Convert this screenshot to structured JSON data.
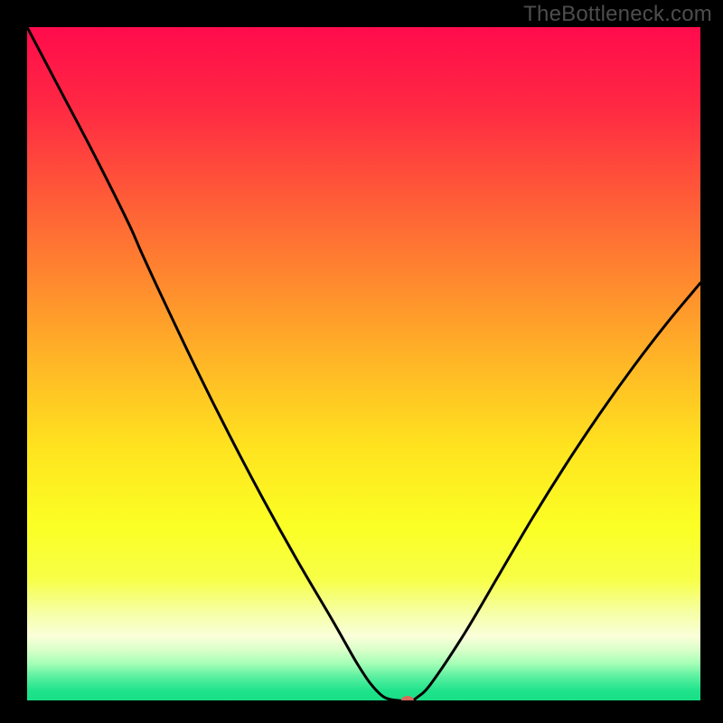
{
  "watermark": "TheBottleneck.com",
  "chart_data": {
    "type": "line",
    "title": "",
    "xlabel": "",
    "ylabel": "",
    "xlim": [
      0,
      100
    ],
    "ylim": [
      0,
      100
    ],
    "background_gradient": {
      "stops": [
        {
          "offset": 0.0,
          "color": "#ff0b4c"
        },
        {
          "offset": 0.12,
          "color": "#ff2943"
        },
        {
          "offset": 0.25,
          "color": "#ff5a38"
        },
        {
          "offset": 0.38,
          "color": "#ff8a2e"
        },
        {
          "offset": 0.5,
          "color": "#ffb726"
        },
        {
          "offset": 0.62,
          "color": "#ffe21f"
        },
        {
          "offset": 0.74,
          "color": "#fbff24"
        },
        {
          "offset": 0.82,
          "color": "#f7ff47"
        },
        {
          "offset": 0.87,
          "color": "#f6ffa6"
        },
        {
          "offset": 0.905,
          "color": "#faffd9"
        },
        {
          "offset": 0.925,
          "color": "#d9ffc9"
        },
        {
          "offset": 0.945,
          "color": "#a6ffb6"
        },
        {
          "offset": 0.965,
          "color": "#5af0a0"
        },
        {
          "offset": 0.985,
          "color": "#20e38b"
        },
        {
          "offset": 1.0,
          "color": "#19df86"
        }
      ]
    },
    "series": [
      {
        "name": "bottleneck-curve",
        "x": [
          0,
          5,
          10,
          15,
          17,
          20,
          25,
          30,
          35,
          40,
          45,
          47,
          49,
          51,
          53,
          55,
          57,
          58,
          60,
          65,
          70,
          75,
          80,
          85,
          90,
          95,
          100
        ],
        "y": [
          100,
          90.5,
          81,
          71,
          66.5,
          60,
          49.5,
          39.5,
          30,
          21,
          12.5,
          9,
          5.5,
          2.5,
          0.5,
          0,
          0,
          0.5,
          2.5,
          10,
          18.5,
          27,
          35,
          42.5,
          49.5,
          56,
          62
        ]
      }
    ],
    "marker": {
      "x": 56.5,
      "y": 0,
      "color": "#d96a5a",
      "rx": 7,
      "ry": 5
    }
  }
}
